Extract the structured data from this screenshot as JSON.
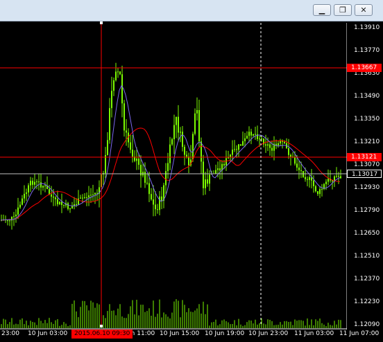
{
  "window": {
    "buttons": [
      {
        "name": "minimize",
        "glyph": "▁"
      },
      {
        "name": "restore",
        "glyph": "❐"
      },
      {
        "name": "close",
        "glyph": "✕"
      }
    ]
  },
  "chart": {
    "price_axis": {
      "ticks": [
        "1.13910",
        "1.13770",
        "1.13630",
        "1.13490",
        "1.13350",
        "1.13210",
        "1.13070",
        "1.12930",
        "1.12790",
        "1.12650",
        "1.12510",
        "1.12370",
        "1.12230",
        "1.12090"
      ]
    },
    "time_axis": {
      "labels": [
        "23:00",
        "10 Jun 03:00",
        "10 Jun 11:00",
        "10 Jun 15:00",
        "10 Jun 19:00",
        "10 Jun 23:00",
        "11 Jun 03:00",
        "11 Jun 07:00"
      ]
    },
    "crosshair": {
      "time_label": "2015.06.10 09:30",
      "price_label": "1.13667"
    },
    "horizontal_lines": [
      {
        "label": "1.13667",
        "color": "#ff0000"
      },
      {
        "label": "1.13121",
        "color": "#ff0000"
      }
    ],
    "current_price": {
      "label": "1.13017",
      "color": "#ffffff"
    },
    "colors": {
      "background": "#000000",
      "candles": "#7cfc00",
      "ma_fast": "#7b68ee",
      "ma_slow": "#ff0000",
      "axis_text": "#ffffff"
    }
  }
}
